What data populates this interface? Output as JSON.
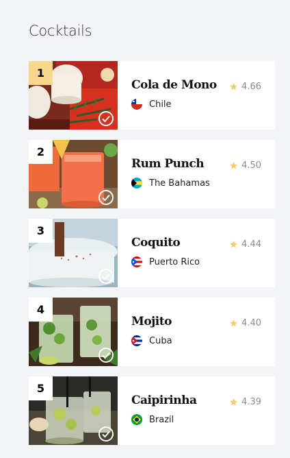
{
  "page": {
    "title": "Cocktails"
  },
  "colors": {
    "star": "#f3cd6a",
    "rank_first_bg": "#f7d88a"
  },
  "cocktails": [
    {
      "rank": "1",
      "name": "Cola de Mono",
      "country": "Chile",
      "rating": "4.66",
      "flag_icon": "chile-flag-icon",
      "image": "cola-de-mono-photo"
    },
    {
      "rank": "2",
      "name": "Rum Punch",
      "country": "The Bahamas",
      "rating": "4.50",
      "flag_icon": "bahamas-flag-icon",
      "image": "rum-punch-photo"
    },
    {
      "rank": "3",
      "name": "Coquito",
      "country": "Puerto Rico",
      "rating": "4.44",
      "flag_icon": "puerto-rico-flag-icon",
      "image": "coquito-photo"
    },
    {
      "rank": "4",
      "name": "Mojito",
      "country": "Cuba",
      "rating": "4.40",
      "flag_icon": "cuba-flag-icon",
      "image": "mojito-photo"
    },
    {
      "rank": "5",
      "name": "Caipirinha",
      "country": "Brazil",
      "rating": "4.39",
      "flag_icon": "brazil-flag-icon",
      "image": "caipirinha-photo"
    }
  ]
}
